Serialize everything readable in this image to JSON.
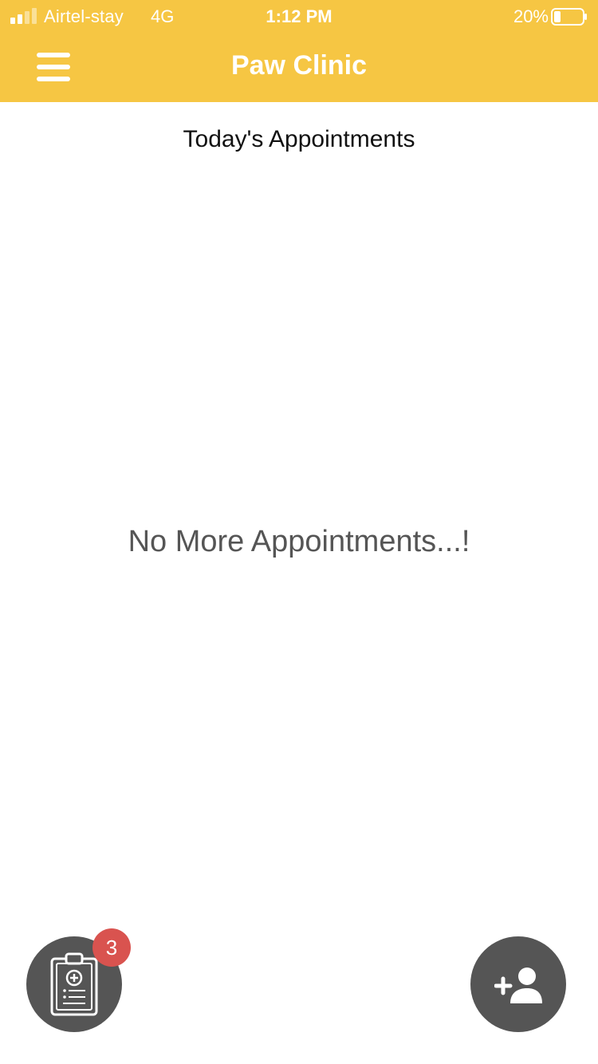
{
  "status_bar": {
    "carrier": "Airtel-stay",
    "network": "4G",
    "time": "1:12 PM",
    "battery": "20%"
  },
  "header": {
    "title": "Paw Clinic",
    "menu_icon": "hamburger-menu-icon"
  },
  "main": {
    "section_title": "Today's Appointments",
    "empty_message": "No More Appointments...!"
  },
  "fab_left": {
    "icon": "medical-clipboard-icon",
    "badge_count": "3"
  },
  "fab_right": {
    "icon": "add-person-icon"
  },
  "colors": {
    "header_bg": "#f6c643",
    "fab_bg": "#555555",
    "badge_bg": "#d9534f"
  }
}
